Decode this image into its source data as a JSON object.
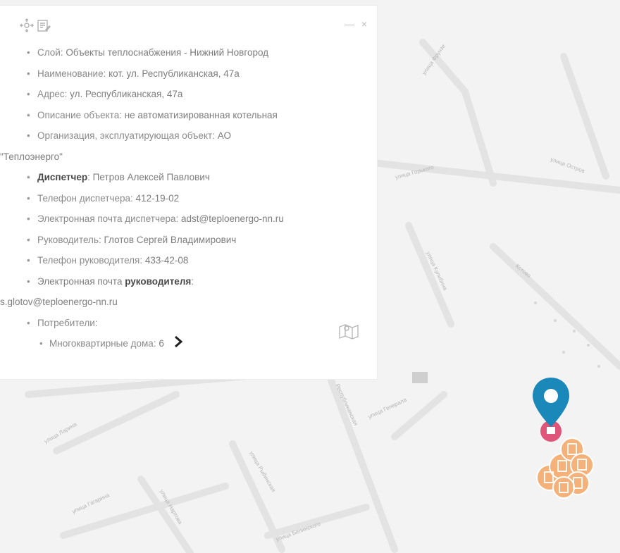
{
  "popup": {
    "close_label": "×",
    "minimize_label": "—",
    "layer": {
      "label": "Слой:",
      "value": " Объекты теплоснабжения - Нижний Новгород"
    },
    "name": {
      "label": "Наименование:",
      "value": " кот. ул. Республиканская, 47а"
    },
    "address": {
      "label": "Адрес:",
      "value": " ул. Республиканская, 47а"
    },
    "description": {
      "label": "Описание объекта:",
      "value": " не автоматизированная котельная"
    },
    "organization": {
      "label": "Организация, эксплуатирующая объект:",
      "value_line1": " АО",
      "value_line2": "\"Теплоэнерго\""
    },
    "dispatcher": {
      "label": "Диспетчер",
      "value": ": Петров Алексей Павлович"
    },
    "dispatcher_phone": {
      "label": "Телефон диспетчера:",
      "value": " 412-19-02"
    },
    "dispatcher_email": {
      "label": "Электронная почта диспетчера:",
      "value": " adst@teploenergo-nn.ru"
    },
    "manager": {
      "label": "Руководитель:",
      "value": " Глотов Сергей Владимирович"
    },
    "manager_phone": {
      "label": "Телефон руководителя:",
      "value": " 433-42-08"
    },
    "manager_email": {
      "label_prefix": "Электронная почта ",
      "label_bold": "руководителя",
      "label_suffix": ":",
      "value": "s.glotov@teploenergo-nn.ru"
    },
    "consumers": {
      "label": "Потребители:"
    },
    "apartment_buildings": {
      "label": "Многоквартирные дома:",
      "value": " 6"
    }
  },
  "map": {
    "street_labels": [
      "улица Фрунзе",
      "улица Горького",
      "улица Остров",
      "улица Генерала",
      "улица Ларина",
      "Республиканская",
      "улица Гагарина",
      "улица Нартова",
      "улица Рыбинская",
      "улица Белинского",
      "Кстово",
      "улица Кулибина"
    ],
    "colors": {
      "pin": "#1a88b8",
      "cluster": "#f2a15a",
      "poi": "#e0557a"
    }
  }
}
